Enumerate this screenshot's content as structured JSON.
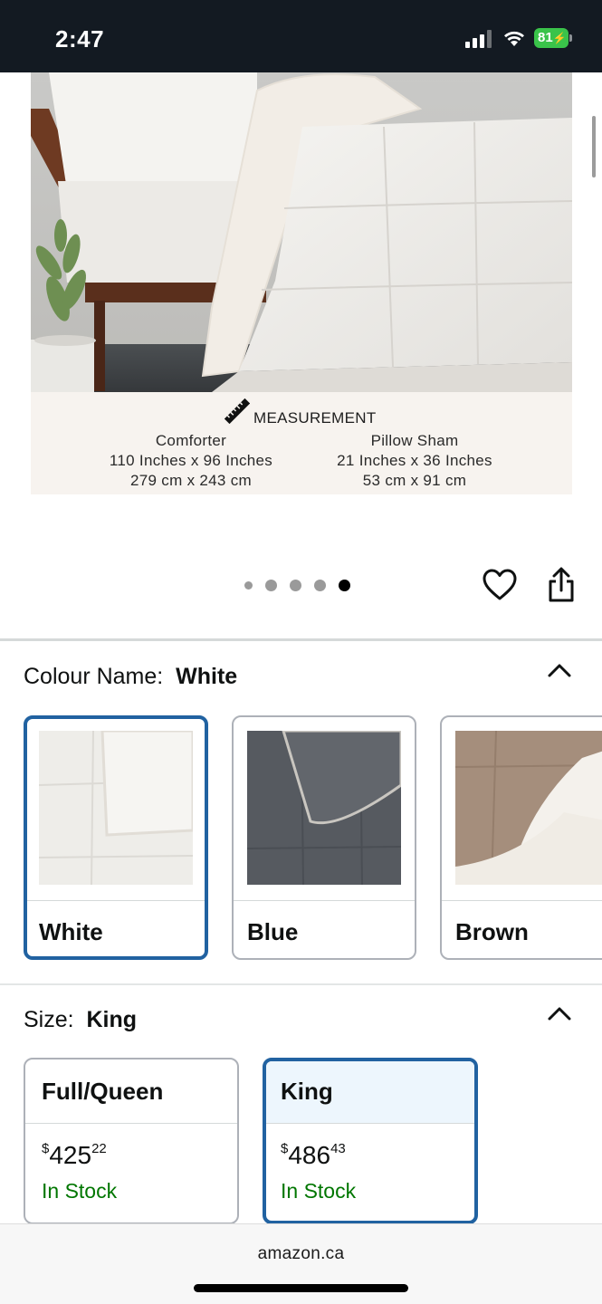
{
  "status_bar": {
    "time": "2:47",
    "battery": "81",
    "icons": [
      "signal-icon",
      "wifi-icon",
      "battery-icon"
    ]
  },
  "product_image": {
    "measurement_title": "MEASUREMENT",
    "comforter": {
      "title": "Comforter",
      "inches": "110 Inches x 96 Inches",
      "cm": "279 cm x 243 cm"
    },
    "pillow_sham": {
      "title": "Pillow Sham",
      "inches": "21 Inches x 36 Inches",
      "cm": "53 cm x 91 cm"
    }
  },
  "carousel": {
    "image_count": 5,
    "active_index": 4
  },
  "actions": [
    "heart-icon",
    "share-icon"
  ],
  "colour": {
    "label": "Colour Name:",
    "value": "White",
    "options": [
      {
        "name": "White",
        "selected": true
      },
      {
        "name": "Blue",
        "selected": false
      },
      {
        "name": "Brown",
        "selected": false
      }
    ]
  },
  "size": {
    "label": "Size:",
    "value": "King",
    "options": [
      {
        "name": "Full/Queen",
        "currency": "$",
        "price_main": "425",
        "price_cents": "22",
        "stock": "In Stock",
        "selected": false
      },
      {
        "name": "King",
        "currency": "$",
        "price_main": "486",
        "price_cents": "43",
        "stock": "In Stock",
        "selected": true
      }
    ]
  },
  "browser": {
    "url": "amazon.ca"
  },
  "colors": {
    "selected_border": "#2162a1",
    "in_stock": "#007600",
    "status_bar_bg": "#131a22"
  }
}
